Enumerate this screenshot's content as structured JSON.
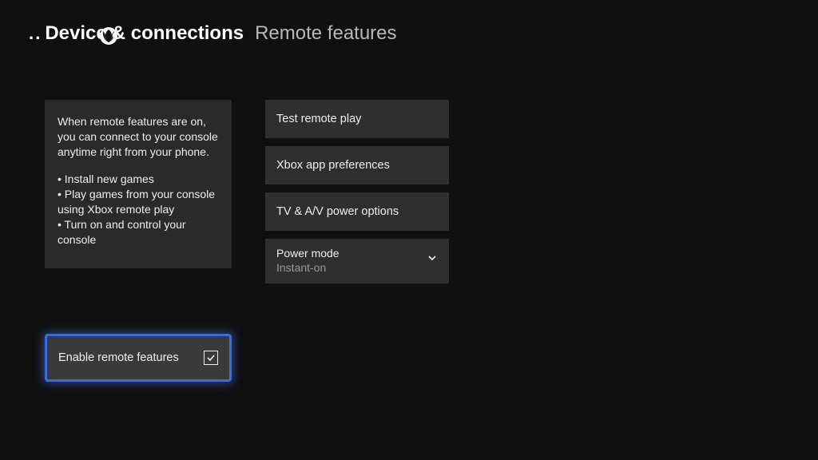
{
  "header": {
    "dots": ". .",
    "breadcrumb_main": "Devices & connections",
    "breadcrumb_sub": "Remote features"
  },
  "info": {
    "intro": "When remote features are on, you can connect to your console anytime right from your phone.",
    "bullets": [
      "• Install new games",
      "• Play games from your console using Xbox remote play",
      "• Turn on and control your console"
    ]
  },
  "enable_checkbox": {
    "label": "Enable remote features",
    "checked": true
  },
  "options": {
    "test_remote_play": "Test remote play",
    "xbox_app_prefs": "Xbox app preferences",
    "tv_av_power": "TV & A/V power options",
    "power_mode": {
      "label": "Power mode",
      "value": "Instant-on"
    }
  }
}
